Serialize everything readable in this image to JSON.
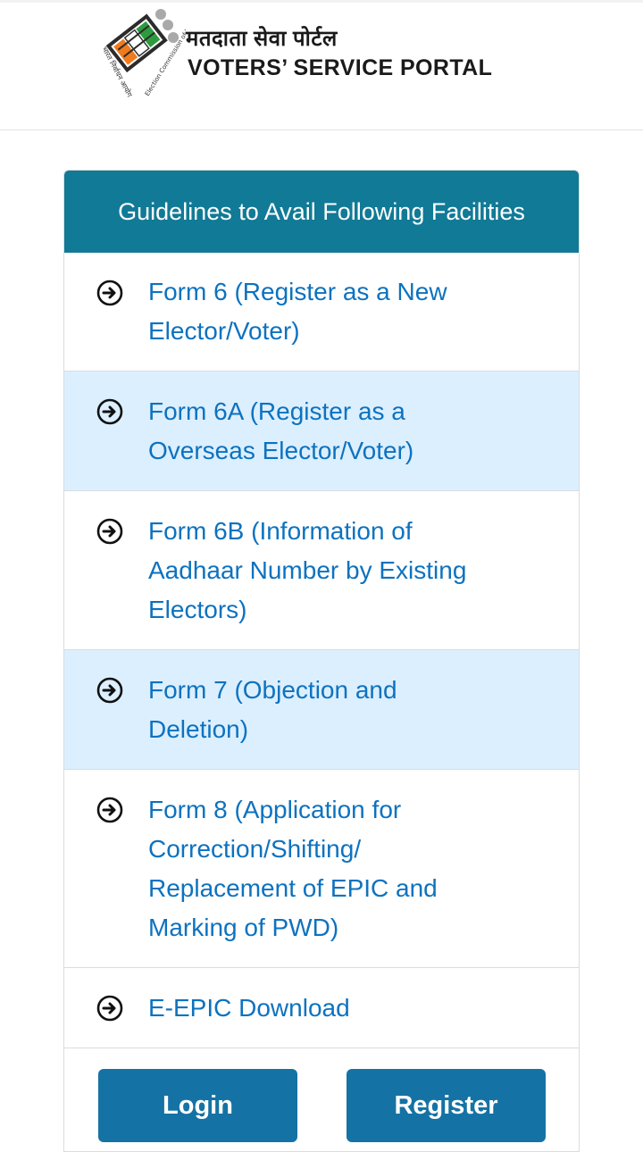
{
  "header": {
    "title_hindi": "मतदाता सेवा पोर्टल",
    "title_english": "VOTERS’ SERVICE PORTAL",
    "logo_text_left": "भारत निर्वाचन आयोग",
    "logo_text_right": "Election Commission of India"
  },
  "card": {
    "title": "Guidelines to Avail Following Facilities",
    "items": [
      {
        "label": "Form 6 (Register as a New Elector/Voter)",
        "icon": "circle-arrow-right-icon"
      },
      {
        "label": "Form 6A (Register as a Overseas Elector/Voter)",
        "icon": "circle-arrow-right-icon"
      },
      {
        "label": "Form 6B (Information of Aadhaar Number by Existing Electors)",
        "icon": "circle-arrow-right-icon"
      },
      {
        "label": "Form 7 (Objection and Deletion)",
        "icon": "circle-arrow-right-icon"
      },
      {
        "label": "Form 8 (Application for Correction/Shifting/ Replacement of EPIC and Marking of PWD)",
        "icon": "circle-arrow-right-icon"
      },
      {
        "label": "E-EPIC Download",
        "icon": "circle-arrow-right-icon"
      }
    ]
  },
  "buttons": {
    "login": "Login",
    "register": "Register"
  },
  "colors": {
    "header_bg": "#117a96",
    "link": "#0d72bf",
    "alt_row": "#dcefff",
    "button": "#1572a4"
  }
}
